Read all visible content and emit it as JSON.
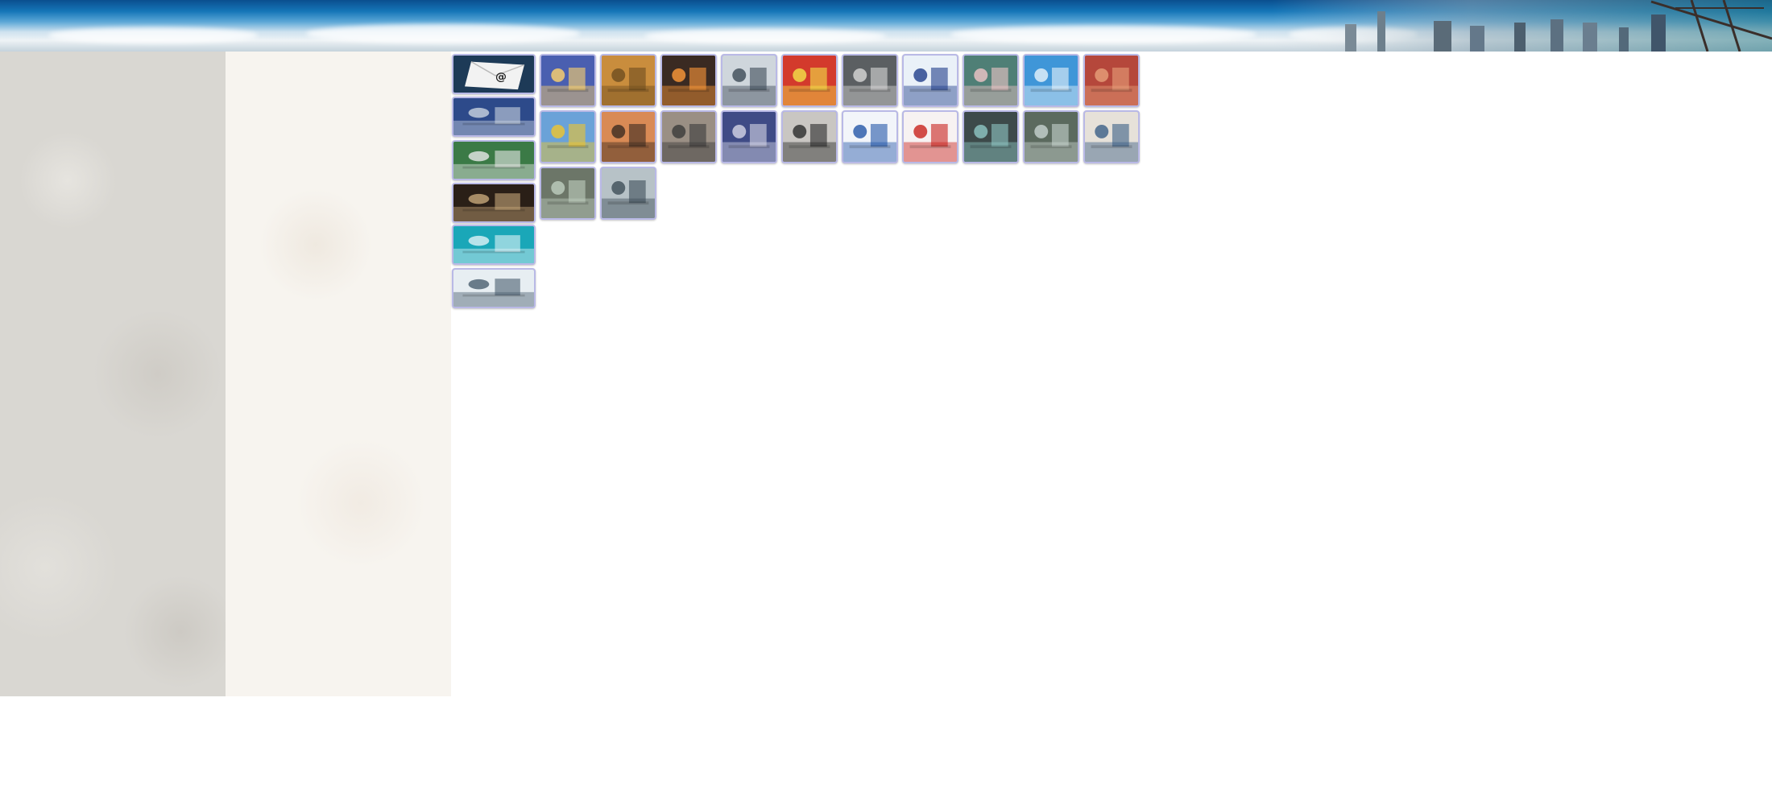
{
  "page": {
    "background": "#ffffff"
  },
  "side_tiles": [
    {
      "name": "email-envelope-icon",
      "color": "#1d3a57",
      "accent": "#f2f2f2"
    },
    {
      "name": "building-photo",
      "color": "#2d4a8a",
      "accent": "#c9d3e0"
    },
    {
      "name": "classroom-hands-photo",
      "color": "#3b7a46",
      "accent": "#e8e8e8"
    },
    {
      "name": "alarm-clock-photo",
      "color": "#2a1f17",
      "accent": "#c7a77a"
    },
    {
      "name": "smartphone-hand-photo",
      "color": "#1aa7b8",
      "accent": "#e0f3f6"
    },
    {
      "name": "office-meeting-photo",
      "color": "#e7eef2",
      "accent": "#4a5e6e"
    }
  ],
  "grid_tiles": [
    [
      {
        "name": "sunset-crane-photo",
        "color": "#4a5fb0",
        "accent": "#ffd36b"
      },
      {
        "name": "scaffold-tower-photo",
        "color": "#c98d3d",
        "accent": "#6e4d1f"
      },
      {
        "name": "welding-sparks-photo",
        "color": "#3a2a22",
        "accent": "#ff9a3a"
      },
      {
        "name": "training-room-photo",
        "color": "#cfd6dc",
        "accent": "#3c4a56"
      },
      {
        "name": "workers-hardhats-photo",
        "color": "#d33a2c",
        "accent": "#f2e34a"
      },
      {
        "name": "office-desks-photo",
        "color": "#5b5f62",
        "accent": "#d8d8d8"
      },
      {
        "name": "inspector-board-photo",
        "color": "#eaf1f8",
        "accent": "#1f3d8a"
      },
      {
        "name": "computer-operator-photo",
        "color": "#4f7f76",
        "accent": "#f0c6c8"
      },
      {
        "name": "tower-crane-sky-photo",
        "color": "#3f96d8",
        "accent": "#e9f4fb"
      },
      {
        "name": "rebar-work-photo",
        "color": "#b5473b",
        "accent": "#e7a07a"
      }
    ],
    [
      {
        "name": "engineers-site-photo",
        "color": "#6aa2d8",
        "accent": "#f0c52d"
      },
      {
        "name": "crane-orange-sky-photo",
        "color": "#d98a55",
        "accent": "#3b2a20"
      },
      {
        "name": "site-inspection-photo",
        "color": "#9a8f84",
        "accent": "#3a3a3a"
      },
      {
        "name": "stage-meeting-photo",
        "color": "#3f4b86",
        "accent": "#d6d6e6"
      },
      {
        "name": "group-visit-photo",
        "color": "#c9c6c2",
        "accent": "#2a2a2a"
      },
      {
        "name": "website-screenshot-blue",
        "color": "#f2f5fa",
        "accent": "#2356a8"
      },
      {
        "name": "website-screenshot-red",
        "color": "#f7f2f2",
        "accent": "#c8221c"
      },
      {
        "name": "monitor-room-photo",
        "color": "#3d4a4a",
        "accent": "#8fc7c4"
      },
      {
        "name": "control-center-photo",
        "color": "#5b6a5e",
        "accent": "#c7d3cf"
      },
      {
        "name": "drafting-desk-photo",
        "color": "#e6e1d9",
        "accent": "#3b5f86"
      }
    ],
    [
      {
        "name": "cctv-wall-photo",
        "color": "#6c7668",
        "accent": "#bfcfbf"
      },
      {
        "name": "operator-screens-photo",
        "color": "#b7c2c7",
        "accent": "#3d4d58"
      }
    ]
  ]
}
